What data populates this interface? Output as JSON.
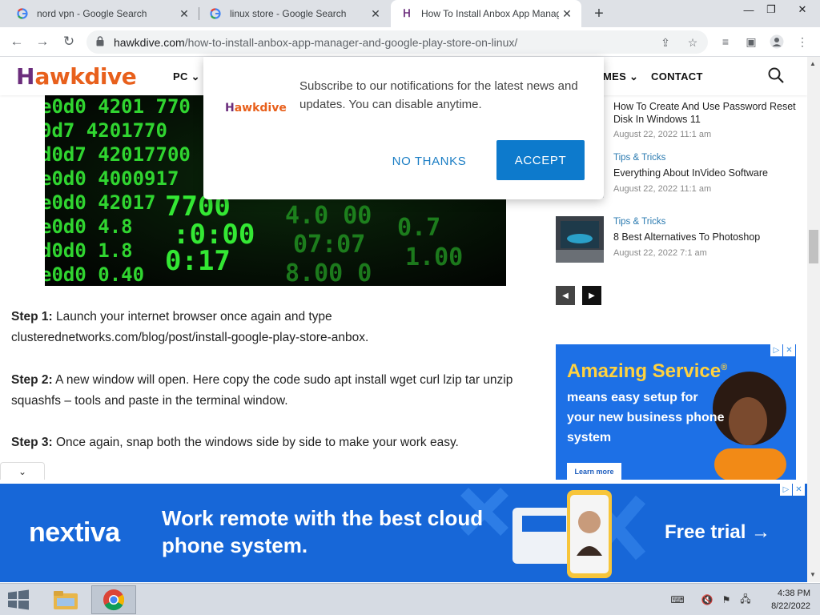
{
  "browser": {
    "tabs": [
      {
        "title": "nord vpn - Google Search",
        "favicon": "google-g-icon"
      },
      {
        "title": "linux store - Google Search",
        "favicon": "google-g-icon"
      },
      {
        "title": "How To Install Anbox App Manager",
        "favicon": "hawkdive-favicon"
      }
    ],
    "url_domain": "hawkdive.com",
    "url_path": "/how-to-install-anbox-app-manager-and-google-play-store-on-linux/"
  },
  "site": {
    "logo_mark": "H",
    "logo_text": "awkdive",
    "nav": {
      "pc": "PC",
      "games_partial": "MES",
      "contact": "CONTACT"
    }
  },
  "popup": {
    "logo_mark": "H",
    "logo_text": "awkdive",
    "message": "Subscribe to our notifications for the latest news and updates. You can disable anytime.",
    "decline": "NO THANKS",
    "accept": "ACCEPT"
  },
  "article": {
    "steps": [
      {
        "label": "Step 1:",
        "text": " Launch your internet browser once again and type clusterednetworks.com/blog/post/install-google-play-store-anbox."
      },
      {
        "label": "Step 2:",
        "text": " A new window will open. Here copy the code sudo apt install wget curl lzip tar unzip squashfs – tools and paste in the terminal window."
      },
      {
        "label": "Step 3:",
        "text": " Once again, snap both the windows side by side to make your work easy."
      }
    ]
  },
  "sidebar": {
    "posts": [
      {
        "category": "",
        "title": "How To Create And Use Password Reset Disk In Windows 11",
        "date": "August 22, 2022 11:1 am"
      },
      {
        "category": "Tips & Tricks",
        "title": "Everything About InVideo Software",
        "date": "August 22, 2022 11:1 am"
      },
      {
        "category": "Tips & Tricks",
        "title": "8 Best Alternatives To Photoshop",
        "date": "August 22, 2022 7:1 am"
      }
    ]
  },
  "side_ad": {
    "headline": "Amazing Service",
    "reg": "®",
    "body": "means easy setup for your new business phone system",
    "cta": "Learn more"
  },
  "bottom_ad": {
    "brand": "nextiva",
    "headline": "Work remote with the best cloud phone system.",
    "cta": "Free trial →"
  },
  "taskbar": {
    "time": "4:38 PM",
    "date": "8/22/2022"
  },
  "colors": {
    "brand_purple": "#6b2d7c",
    "brand_orange": "#e8601c",
    "accept_blue": "#0d7acc",
    "ad_blue": "#1767d8",
    "link_blue": "#2a7ab0"
  }
}
